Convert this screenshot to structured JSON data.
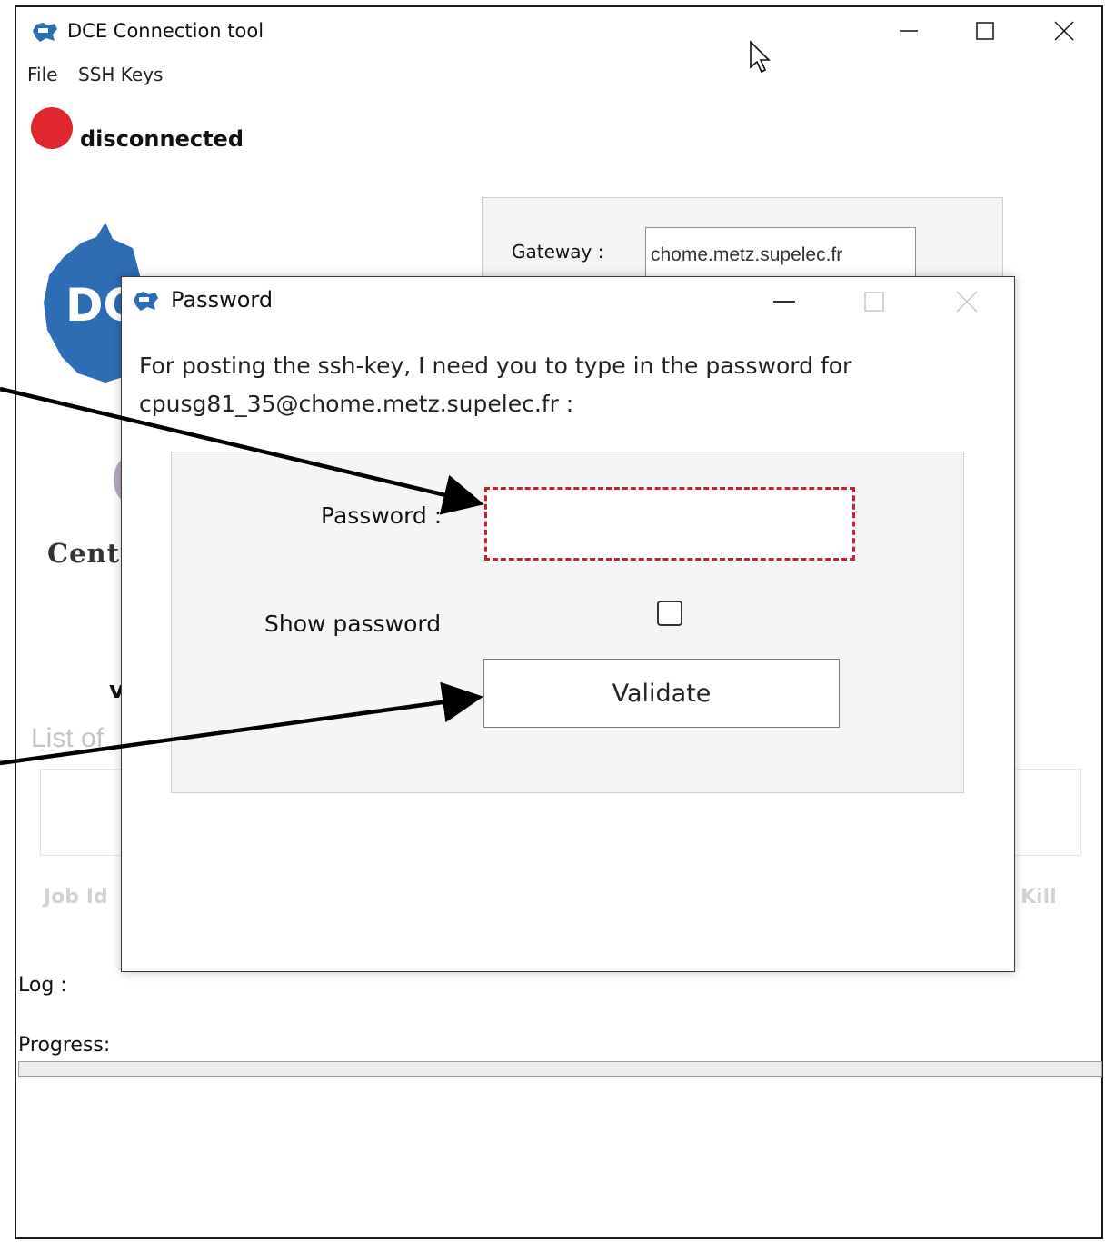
{
  "main_window": {
    "title": "DCE Connection tool",
    "icon": "dce-app-icon",
    "controls": {
      "minimize": "minimize-icon",
      "maximize": "maximize-icon",
      "close": "close-icon"
    },
    "menu": [
      "File",
      "SSH Keys"
    ],
    "status": {
      "text": "disconnected",
      "color": "#e0262e"
    },
    "gateway": {
      "label": "Gateway :",
      "value": "chome.metz.supelec.fr"
    },
    "logo_fragments": {
      "left_text": "DC",
      "centrale_text": "Centr",
      "v_text": "v"
    },
    "list_label": "List of",
    "table_headers": {
      "job_id": "Job Id",
      "kill": "Kill"
    },
    "log_label": "Log :",
    "progress_label": "Progress:",
    "progress_value": 0
  },
  "password_dialog": {
    "title": "Password",
    "icon": "dce-app-icon",
    "message_line1": "For posting the ssh-key, I need you to type in the password for",
    "message_line2": "cpusg81_35@chome.metz.supelec.fr :",
    "password_label": "Password :",
    "password_value": "",
    "show_password_label": "Show password",
    "show_password_checked": false,
    "validate_label": "Validate",
    "highlight_color": "#cc1f2a"
  },
  "annotations": {
    "arrows": [
      "arrow-to-password-field",
      "arrow-to-validate-button"
    ]
  }
}
